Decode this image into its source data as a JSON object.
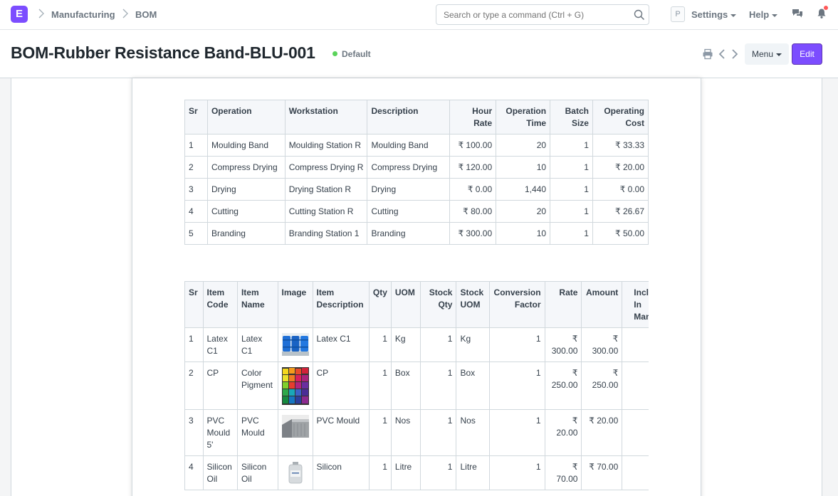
{
  "navbar": {
    "logo_letter": "E",
    "breadcrumbs": [
      "Manufacturing",
      "BOM"
    ],
    "search_placeholder": "Search or type a command (Ctrl + G)",
    "avatar_letter": "P",
    "settings_label": "Settings",
    "help_label": "Help"
  },
  "page_head": {
    "title": "BOM-Rubber Resistance Band-BLU-001",
    "status": "Default",
    "menu_label": "Menu",
    "edit_label": "Edit"
  },
  "colors": {
    "brand": "#7c4dff",
    "status_green": "#5ad35a",
    "notification_red": "#ff5858"
  },
  "operations_table": {
    "headers": [
      "Sr",
      "Operation",
      "Workstation",
      "Description",
      "Hour Rate",
      "Operation Time",
      "Batch Size",
      "Operating Cost"
    ],
    "rows": [
      [
        "1",
        "Moulding Band",
        "Moulding Station R",
        "Moulding Band",
        "₹ 100.00",
        "20",
        "1",
        "₹ 33.33"
      ],
      [
        "2",
        "Compress Drying",
        "Compress Drying R",
        "Compress Drying",
        "₹ 120.00",
        "10",
        "1",
        "₹ 20.00"
      ],
      [
        "3",
        "Drying",
        "Drying Station R",
        "Drying",
        "₹ 0.00",
        "1,440",
        "1",
        "₹ 0.00"
      ],
      [
        "4",
        "Cutting",
        "Cutting Station R",
        "Cutting",
        "₹ 80.00",
        "20",
        "1",
        "₹ 26.67"
      ],
      [
        "5",
        "Branding",
        "Branding Station 1",
        "Branding",
        "₹ 300.00",
        "10",
        "1",
        "₹ 50.00"
      ]
    ]
  },
  "items_table": {
    "headers": [
      "Sr",
      "Item Code",
      "Item Name",
      "Image",
      "Item Description",
      "Qty",
      "UOM",
      "Stock Qty",
      "Stock UOM",
      "Conversion Factor",
      "Rate",
      "Amount",
      "Include Item In Manufacturing"
    ],
    "rows": [
      {
        "sr": "1",
        "code": "Latex C1",
        "name": "Latex C1",
        "image": "latex-drums-image",
        "desc": "Latex C1",
        "qty": "1",
        "uom": "Kg",
        "stock_qty": "1",
        "stock_uom": "Kg",
        "factor": "1",
        "rate": "₹ 300.00",
        "amount": "₹ 300.00"
      },
      {
        "sr": "2",
        "code": "CP",
        "name": "Color Pigment",
        "image": "color-pigment-image",
        "desc": "CP",
        "qty": "1",
        "uom": "Box",
        "stock_qty": "1",
        "stock_uom": "Box",
        "factor": "1",
        "rate": "₹ 250.00",
        "amount": "₹ 250.00"
      },
      {
        "sr": "3",
        "code": "PVC Mould 5'",
        "name": "PVC Mould",
        "image": "pvc-mould-image",
        "desc": "PVC Mould",
        "qty": "1",
        "uom": "Nos",
        "stock_qty": "1",
        "stock_uom": "Nos",
        "factor": "1",
        "rate": "₹ 20.00",
        "amount": "₹ 20.00"
      },
      {
        "sr": "4",
        "code": "Silicon Oil",
        "name": "Silicon Oil",
        "image": "silicon-oil-bottle-image",
        "desc": "Silicon",
        "qty": "1",
        "uom": "Litre",
        "stock_qty": "1",
        "stock_uom": "Litre",
        "factor": "1",
        "rate": "₹ 70.00",
        "amount": "₹ 70.00"
      }
    ]
  }
}
